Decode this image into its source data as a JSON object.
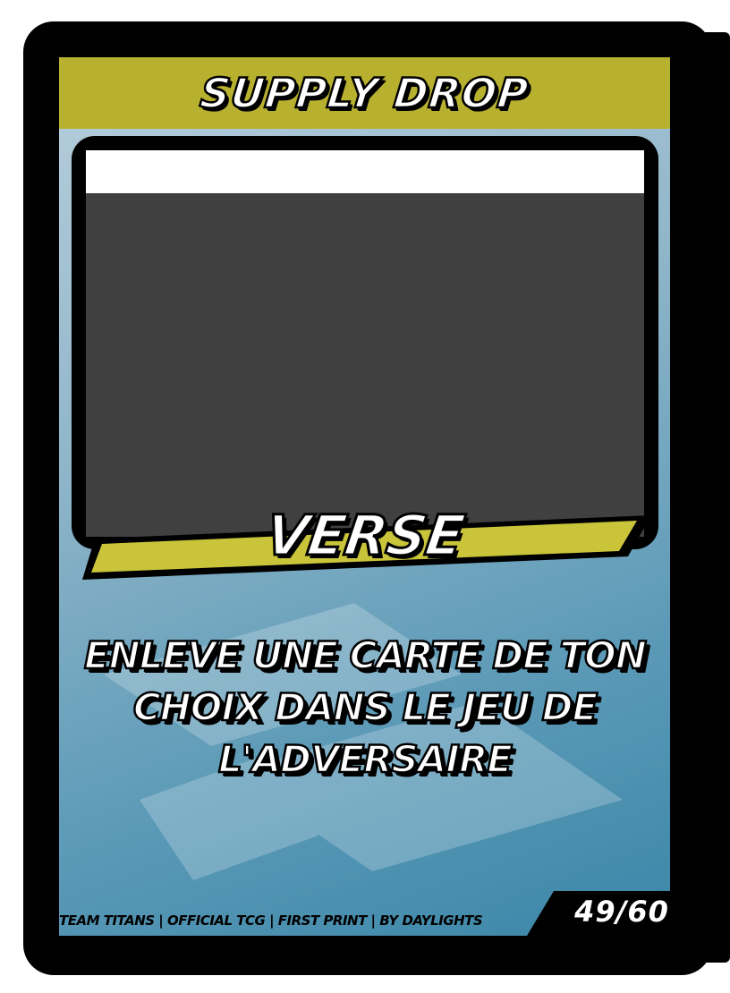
{
  "card": {
    "title": "SUPPLY DROP",
    "type": "VERSE",
    "effect": "ENLEVE UNE CARTE DE TON CHOIX DANS LE JEU DE L'ADVERSAIRE",
    "footer": "TEAM TITANS | OFFICIAL TCG | FIRST PRINT | BY DAYLIGHTS",
    "number": "49/60"
  },
  "colors": {
    "title_bar": "#b8b12f",
    "ribbon": "#c9c43a",
    "art_placeholder": "#404040",
    "background_top": "#b9cfdc",
    "background_bottom": "#3b86a8"
  }
}
